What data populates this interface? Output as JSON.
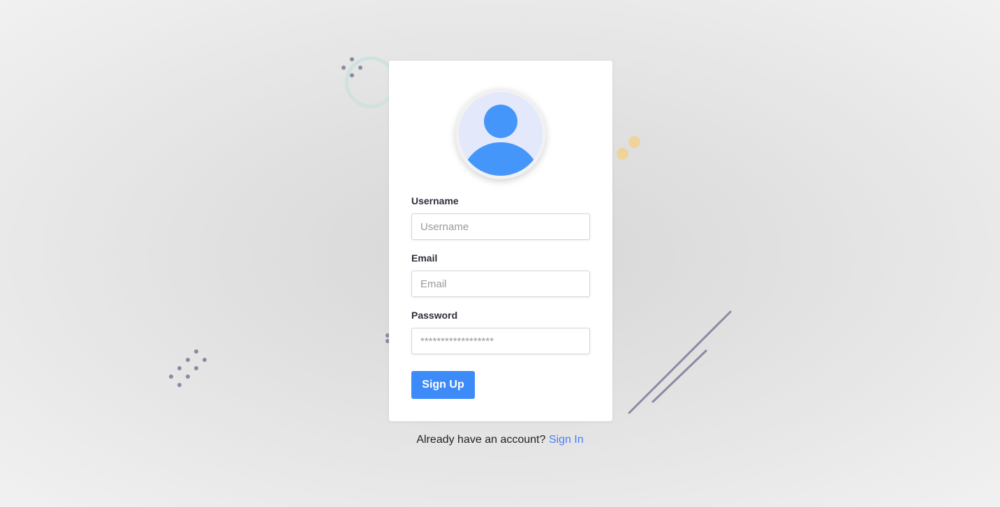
{
  "form": {
    "username_label": "Username",
    "username_placeholder": "Username",
    "username_value": "",
    "email_label": "Email",
    "email_placeholder": "Email",
    "email_value": "",
    "password_label": "Password",
    "password_placeholder": "******************",
    "password_value": "",
    "submit_label": "Sign Up"
  },
  "footer": {
    "prompt": "Already have an account?",
    "link_label": "Sign In"
  },
  "avatar": {
    "icon": "user-avatar-icon"
  },
  "colors": {
    "accent": "#3d8bf8",
    "link": "#4b7ef0",
    "avatar_fill": "#4596fa",
    "avatar_bg": "#e3e9fb"
  }
}
